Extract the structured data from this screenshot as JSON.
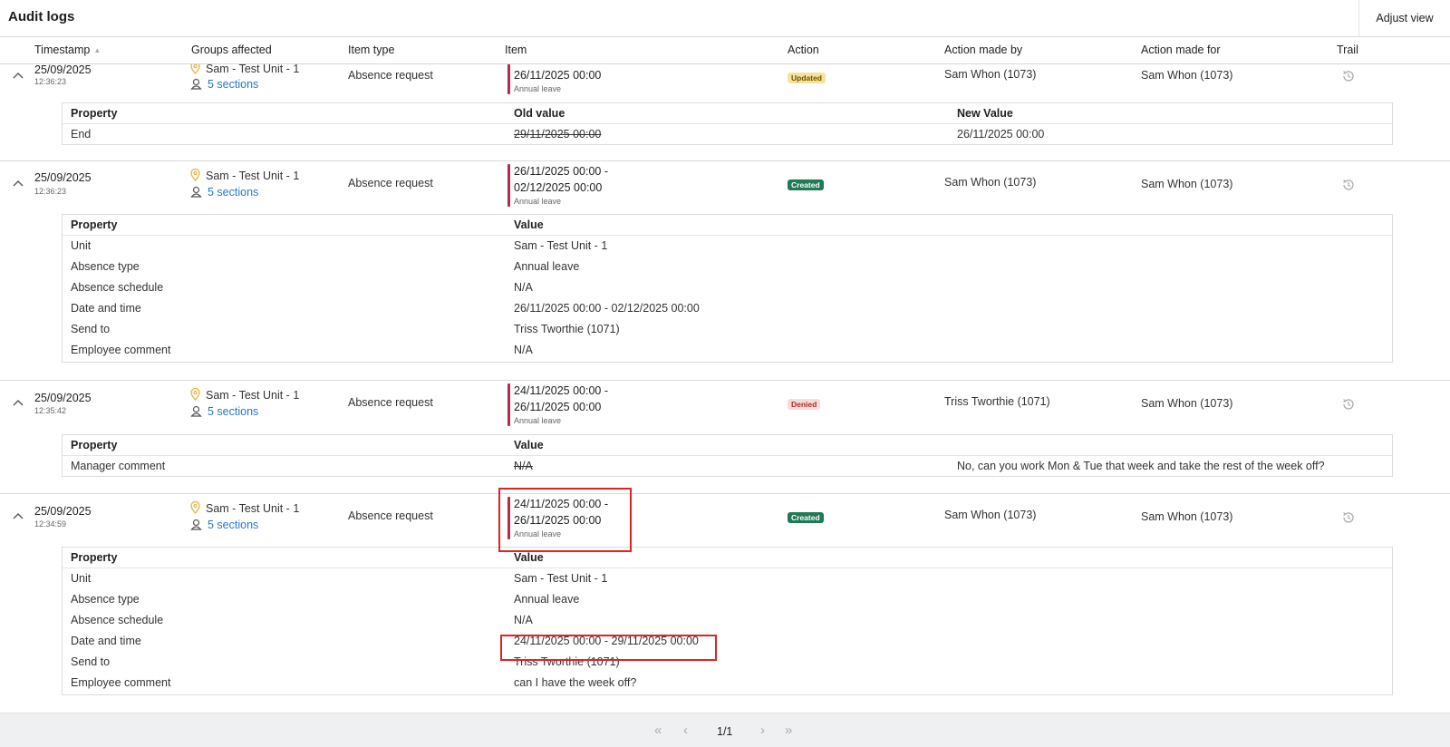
{
  "header": {
    "title": "Audit logs",
    "adjust_view": "Adjust view"
  },
  "columns": {
    "timestamp": "Timestamp",
    "groups": "Groups affected",
    "item_type": "Item type",
    "item": "Item",
    "action": "Action",
    "made_by": "Action made by",
    "made_for": "Action made for",
    "trail": "Trail"
  },
  "rows": [
    {
      "date": "25/09/2025",
      "time": "12:36:23",
      "unit": "Sam - Test Unit - 1",
      "sections": "5 sections",
      "item_type": "Absence request",
      "item_line1": "26/11/2025 00:00",
      "item_line2": "",
      "item_sub": "Annual leave",
      "action": "Updated",
      "made_by": "Sam Whon (1073)",
      "made_for": "Sam Whon (1073)",
      "detail": {
        "headers": [
          "Property",
          "Old value",
          "New Value"
        ],
        "rows": [
          {
            "property": "End",
            "old": "29/11/2025 00:00",
            "new": "26/11/2025 00:00"
          }
        ]
      }
    },
    {
      "date": "25/09/2025",
      "time": "12:36:23",
      "unit": "Sam - Test Unit - 1",
      "sections": "5 sections",
      "item_type": "Absence request",
      "item_line1": "26/11/2025 00:00 -",
      "item_line2": "02/12/2025 00:00",
      "item_sub": "Annual leave",
      "action": "Created",
      "made_by": "Sam Whon (1073)",
      "made_for": "Sam Whon (1073)",
      "detail": {
        "headers": [
          "Property",
          "Value"
        ],
        "rows": [
          {
            "property": "Unit",
            "value": "Sam - Test Unit - 1"
          },
          {
            "property": "Absence type",
            "value": "Annual leave"
          },
          {
            "property": "Absence schedule",
            "value": "N/A"
          },
          {
            "property": "Date and time",
            "value": "26/11/2025 00:00 - 02/12/2025 00:00"
          },
          {
            "property": "Send to",
            "value": "Triss Tworthie (1071)"
          },
          {
            "property": "Employee comment",
            "value": "N/A"
          }
        ]
      }
    },
    {
      "date": "25/09/2025",
      "time": "12:35:42",
      "unit": "Sam - Test Unit - 1",
      "sections": "5 sections",
      "item_type": "Absence request",
      "item_line1": "24/11/2025 00:00 -",
      "item_line2": "26/11/2025 00:00",
      "item_sub": "Annual leave",
      "action": "Denied",
      "made_by": "Triss Tworthie (1071)",
      "made_for": "Sam Whon (1073)",
      "detail": {
        "headers": [
          "Property",
          "Value"
        ],
        "rows": [
          {
            "property": "Manager comment",
            "old": "N/A",
            "new": "No, can you work Mon & Tue that week and take the rest of the week off?"
          }
        ]
      }
    },
    {
      "date": "25/09/2025",
      "time": "12:34:59",
      "unit": "Sam - Test Unit - 1",
      "sections": "5 sections",
      "item_type": "Absence request",
      "item_line1": "24/11/2025 00:00 -",
      "item_line2": "26/11/2025 00:00",
      "item_sub": "Annual leave",
      "action": "Created",
      "made_by": "Sam Whon (1073)",
      "made_for": "Sam Whon (1073)",
      "detail": {
        "headers": [
          "Property",
          "Value"
        ],
        "rows": [
          {
            "property": "Unit",
            "value": "Sam - Test Unit - 1"
          },
          {
            "property": "Absence type",
            "value": "Annual leave"
          },
          {
            "property": "Absence schedule",
            "value": "N/A"
          },
          {
            "property": "Date and time",
            "value": "24/11/2025 00:00 - 29/11/2025 00:00"
          },
          {
            "property": "Send to",
            "value": "Triss Tworthie (1071)"
          },
          {
            "property": "Employee comment",
            "value": "can I have the week off?"
          }
        ]
      }
    }
  ],
  "pagination": {
    "label": "1/1"
  },
  "icons": {
    "expand": "chevron-up-icon",
    "location": "location-pin-icon",
    "sections": "person-pin-icon",
    "trail": "history-icon",
    "first": "double-chevron-left-icon",
    "prev": "chevron-left-icon",
    "next": "chevron-right-icon",
    "last": "double-chevron-right-icon",
    "sort": "sort-icon"
  },
  "colors": {
    "accent_bar": "#b8294a",
    "link": "#2a78c8",
    "pin": "#e8b33a",
    "badge_created": "#1f7a55",
    "badge_updated": "#f6e39b",
    "badge_denied": "#f7dada",
    "highlight": "#e02424"
  }
}
